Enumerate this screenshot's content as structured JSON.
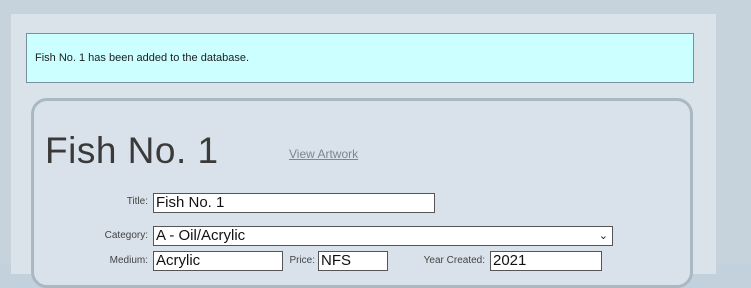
{
  "notice": {
    "text": "Fish No. 1 has been added to the database."
  },
  "artwork": {
    "heading": "Fish No. 1",
    "view_link": "View Artwork"
  },
  "form": {
    "title_label": "Title:",
    "title_value": "Fish No. 1",
    "category_label": "Category:",
    "category_value": "A - Oil/Acrylic",
    "medium_label": "Medium:",
    "medium_value": "Acrylic",
    "price_label": "Price:",
    "price_value": "NFS",
    "year_label": "Year Created:",
    "year_value": "2021"
  },
  "colors": {
    "notice_bg": "#ccffff",
    "panel_bg": "#d9e2ea",
    "page_bg": "#c6d3dd"
  },
  "icons": {
    "select_arrow": "chevron-down-icon"
  }
}
